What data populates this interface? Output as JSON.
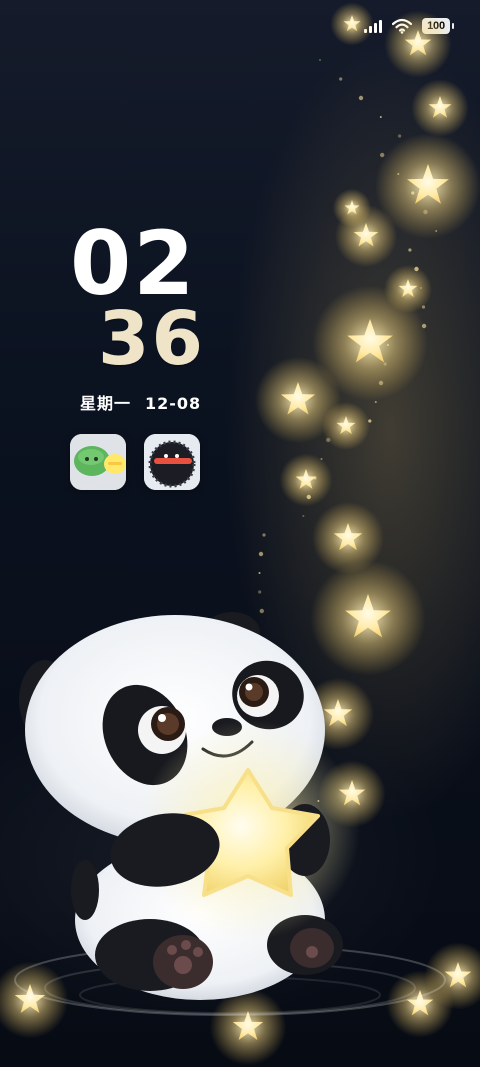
{
  "status_bar": {
    "battery_level": "100",
    "signal_icon": "cellular-signal-icon",
    "wifi_icon": "wifi-icon"
  },
  "lockscreen": {
    "clock_hours": "02",
    "clock_minutes": "36",
    "weekday": "星期一",
    "date": "12-08"
  },
  "widgets": [
    {
      "name": "app-shortcut-green-blob-icon"
    },
    {
      "name": "app-shortcut-dark-creature-icon"
    }
  ],
  "colors": {
    "background": "#0b1220",
    "star_glow": "#ffe59a",
    "minutes_text": "#efe4c7"
  }
}
